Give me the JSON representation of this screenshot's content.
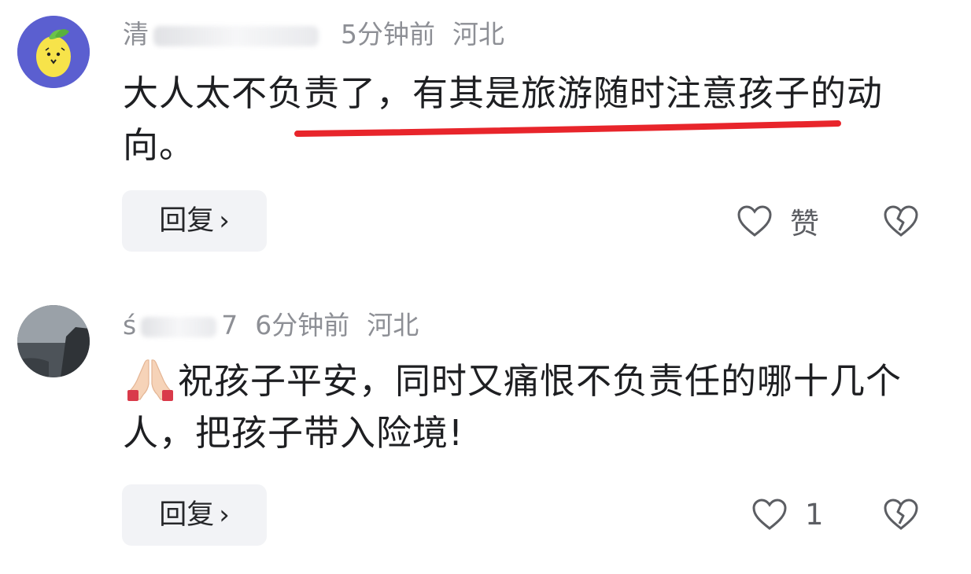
{
  "comments": [
    {
      "author_visible": "清",
      "time": "5分钟前",
      "location": "河北",
      "text": "大人太不负责了，有其是旅游随时注意孩子的动向。",
      "reply_label": "回复",
      "like_label": "赞",
      "like_icon": "heart-outline-icon",
      "dislike_icon": "broken-heart-icon",
      "avatar": "lemon-avatar"
    },
    {
      "author_visible": "ś",
      "author_tail": "7",
      "time": "6分钟前",
      "location": "河北",
      "emoji": "praying-hands",
      "text": "祝孩子平安，同时又痛恨不负责任的哪十几个人，把孩子带入险境!",
      "reply_label": "回复",
      "like_label": "1",
      "like_icon": "heart-outline-icon",
      "dislike_icon": "broken-heart-icon",
      "avatar": "seascape-avatar"
    }
  ],
  "colors": {
    "meta": "#8d8f95",
    "text": "#1e1f22",
    "reply_bg": "#f2f3f6",
    "avatar_1_bg": "#5b5fd0",
    "underline": "#e8252b"
  }
}
